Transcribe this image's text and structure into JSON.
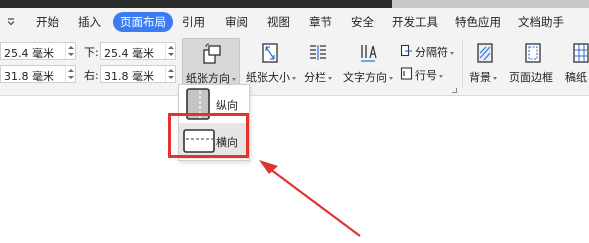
{
  "tabs": [
    {
      "label": "开始"
    },
    {
      "label": "插入"
    },
    {
      "label": "页面布局"
    },
    {
      "label": "引用"
    },
    {
      "label": "审阅"
    },
    {
      "label": "视图"
    },
    {
      "label": "章节"
    },
    {
      "label": "安全"
    },
    {
      "label": "开发工具"
    },
    {
      "label": "特色应用"
    },
    {
      "label": "文档助手"
    }
  ],
  "active_tab": "页面布局",
  "margins": {
    "top": {
      "label": "",
      "value": "25.4 毫米"
    },
    "bottom": {
      "label": "下:",
      "value": "25.4 毫米"
    },
    "left": {
      "label": "",
      "value": "31.8 毫米"
    },
    "right": {
      "label": "右:",
      "value": "31.8 毫米"
    }
  },
  "ribbon": {
    "orientation": "纸张方向",
    "size": "纸张大小",
    "columns": "分栏",
    "text_direction": "文字方向",
    "separator": "分隔符",
    "line_number": "行号",
    "background": "背景",
    "page_border": "页面边框",
    "manuscript": "稿纸"
  },
  "orientation_menu": {
    "portrait": "纵向",
    "landscape": "横向",
    "selected": "横向"
  },
  "colors": {
    "accent": "#3b7cf5",
    "annotation": "#e3332f",
    "ribbon_bg": "#f3f3f3"
  }
}
